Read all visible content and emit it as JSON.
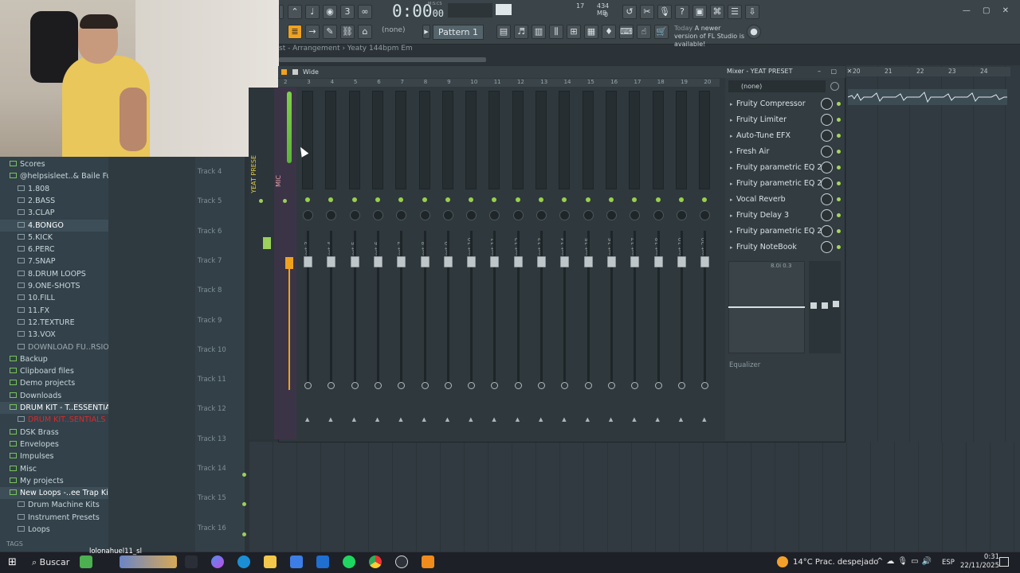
{
  "toolbar": {
    "time": "0:00",
    "time_sub": "00",
    "time_unit": "M:S:CS",
    "pattern": "Pattern 1",
    "none_select": "(none)",
    "cpu_value": "17",
    "ram_value": "434 MB",
    "poly_value": "0",
    "update_today": "Today",
    "update_text": "A newer version of FL Studio is available!"
  },
  "breadcrumb": "st - Arrangement › Yeaty 144bpm Em",
  "browser": {
    "items": [
      {
        "label": "Scores",
        "style": "top"
      },
      {
        "label": "@helpsisleet..& Baile Funk)",
        "style": "top"
      },
      {
        "label": "1.808",
        "style": "sub"
      },
      {
        "label": "2.BASS",
        "style": "sub"
      },
      {
        "label": "3.CLAP",
        "style": "sub"
      },
      {
        "label": "4.BONGO",
        "style": "sub-hl"
      },
      {
        "label": "5.KICK",
        "style": "sub"
      },
      {
        "label": "6.PERC",
        "style": "sub"
      },
      {
        "label": "7.SNAP",
        "style": "sub"
      },
      {
        "label": "8.DRUM LOOPS",
        "style": "sub"
      },
      {
        "label": "9.ONE-SHOTS",
        "style": "sub"
      },
      {
        "label": "10.FILL",
        "style": "sub"
      },
      {
        "label": "11.FX",
        "style": "sub"
      },
      {
        "label": "12.TEXTURE",
        "style": "sub"
      },
      {
        "label": "13.VOX",
        "style": "sub"
      },
      {
        "label": "DOWNLOAD FU..RSION HERE",
        "style": "sub-grey"
      },
      {
        "label": "Backup",
        "style": "top"
      },
      {
        "label": "Clipboard files",
        "style": "top"
      },
      {
        "label": "Demo projects",
        "style": "top"
      },
      {
        "label": "Downloads",
        "style": "top"
      },
      {
        "label": "DRUM KIT - T..ESSENTIALS",
        "style": "top-hl"
      },
      {
        "label": "DRUM KIT..SENTIALS",
        "style": "sub-red"
      },
      {
        "label": "DSK Brass",
        "style": "top"
      },
      {
        "label": "Envelopes",
        "style": "top"
      },
      {
        "label": "Impulses",
        "style": "top"
      },
      {
        "label": "Misc",
        "style": "top"
      },
      {
        "label": "My projects",
        "style": "top"
      },
      {
        "label": "New Loops -..ee Trap Kit 2",
        "style": "top-hl"
      },
      {
        "label": "Drum Machine Kits",
        "style": "sub"
      },
      {
        "label": "Instrument Presets",
        "style": "sub"
      },
      {
        "label": "Loops",
        "style": "sub"
      }
    ],
    "tags_label": "TAGS"
  },
  "tracks": [
    "Track 4",
    "Track 5",
    "Track 6",
    "Track 7",
    "Track 8",
    "Track 9",
    "Track 10",
    "Track 11",
    "Track 12",
    "Track 13",
    "Track 14",
    "Track 15",
    "Track 16"
  ],
  "playlist_ruler": [
    "20",
    "21",
    "22",
    "23",
    "24"
  ],
  "mixer": {
    "title": "Mixer - YEAT PRESET",
    "wide": "Wide",
    "master_name": "YEAT PRESE",
    "mic_name": "MIC",
    "ruler": [
      "2",
      "3",
      "4",
      "5",
      "6",
      "7",
      "8",
      "9",
      "10",
      "11",
      "12",
      "13",
      "14",
      "15",
      "16",
      "17",
      "18",
      "19",
      "20"
    ],
    "inserts": [
      "Insert 3",
      "Insert 4",
      "Insert 5",
      "Insert 6",
      "Insert 7",
      "Insert 8",
      "Insert 9",
      "Insert 10",
      "Insert 11",
      "Insert 12",
      "Insert 13",
      "Insert 14",
      "Insert 15",
      "Insert 16",
      "Insert 17",
      "Insert 18",
      "Insert 19",
      "Insert 20"
    ],
    "fx_select": "(none)",
    "fx_slots": [
      "Fruity Compressor",
      "Fruity Limiter",
      "Auto-Tune EFX",
      "Fresh Air",
      "Fruity parametric EQ 2",
      "Fruity parametric EQ 2",
      "Vocal Reverb",
      "Fruity Delay 3",
      "Fruity parametric EQ 2",
      "Fruity NoteBook"
    ],
    "eq_readout": "8.0i 0.3",
    "equalizer_label": "Equalizer"
  },
  "taskbar": {
    "search": "Buscar",
    "user": "lolonahuel11_sl",
    "weather": "14°C  Prac. despejado",
    "lang": "ESP",
    "time": "0:31",
    "date": "22/11/2025"
  },
  "colors": {
    "accent_orange": "#f0a21e",
    "led_green": "#9bd05a",
    "track_purple": "#3b3446"
  }
}
